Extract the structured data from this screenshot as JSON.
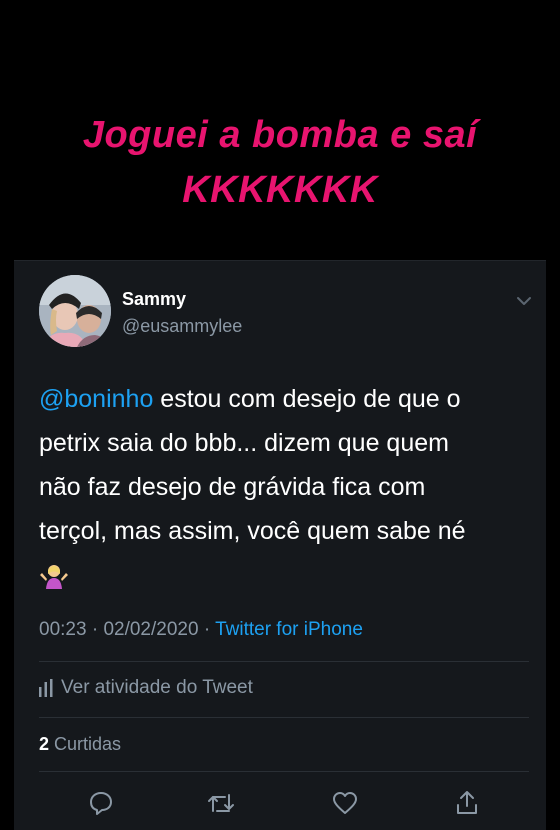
{
  "story": {
    "caption_line1": "Joguei a bomba e saí",
    "caption_line2": "KKKKKKK",
    "caption_color": "#e8146f"
  },
  "tweet": {
    "author_name": "Sammy",
    "author_handle": "@eusammylee",
    "mention": "@boninho",
    "text_line1": " estou com desejo de que o",
    "text_line2": "petrix saia do bbb... dizem que quem",
    "text_line3": "não faz desejo de grávida fica com",
    "text_line4": "terçol, mas assim, você quem sabe né",
    "emoji": "person-shrugging-emoji",
    "time": "00:23",
    "date": "02/02/2020",
    "source": "Twitter for iPhone",
    "activity_label": "Ver atividade do Tweet",
    "likes_count": "2",
    "likes_label": "Curtidas"
  },
  "icons": {
    "menu": "chevron-down-icon",
    "activity": "bar-chart-icon",
    "reply": "reply-icon",
    "retweet": "retweet-icon",
    "like": "heart-icon",
    "share": "share-icon"
  },
  "colors": {
    "background": "#000000",
    "card": "#15181c",
    "accent": "#1da1f2",
    "muted": "#8b98a5"
  }
}
